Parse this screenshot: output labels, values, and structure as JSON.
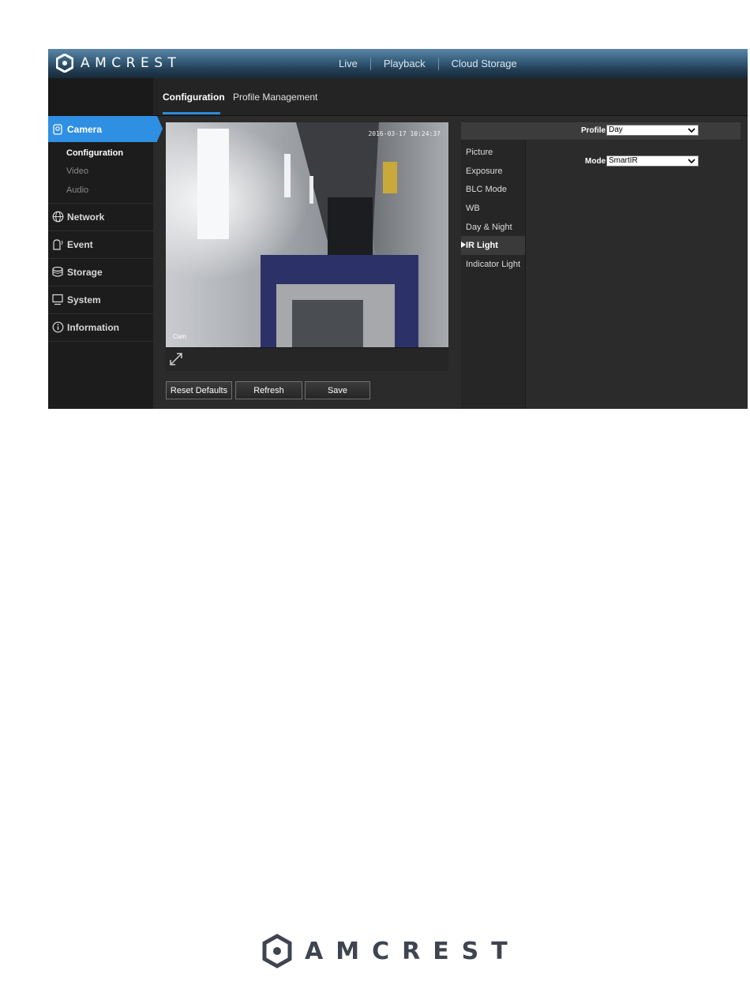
{
  "app": {
    "brand": "AMCREST"
  },
  "top_nav": [
    "Live",
    "Playback",
    "Cloud Storage"
  ],
  "tabs": {
    "configuration": "Configuration",
    "profile_management": "Profile Management"
  },
  "sidebar": {
    "camera": "Camera",
    "camera_sub": [
      "Configuration",
      "Video",
      "Audio"
    ],
    "items": [
      "Network",
      "Event",
      "Storage",
      "System",
      "Information"
    ]
  },
  "video": {
    "timestamp": "2016-03-17 10:24:37",
    "channel": "Cam"
  },
  "buttons": {
    "reset_defaults": "Reset Defaults",
    "refresh": "Refresh",
    "save": "Save"
  },
  "config": {
    "profile_label": "Profile",
    "profile_value": "Day",
    "mode_label": "Mode",
    "mode_value": "SmartIR",
    "menu": [
      "Picture",
      "Exposure",
      "BLC Mode",
      "WB",
      "Day & Night",
      "IR Light",
      "Indicator Light"
    ],
    "active_menu": "IR Light"
  },
  "colors": {
    "accent": "#2f8fe3",
    "panel": "#2b2b2b",
    "sidebar": "#1c1c1c"
  },
  "footer": {
    "brand": "AMCREST"
  }
}
